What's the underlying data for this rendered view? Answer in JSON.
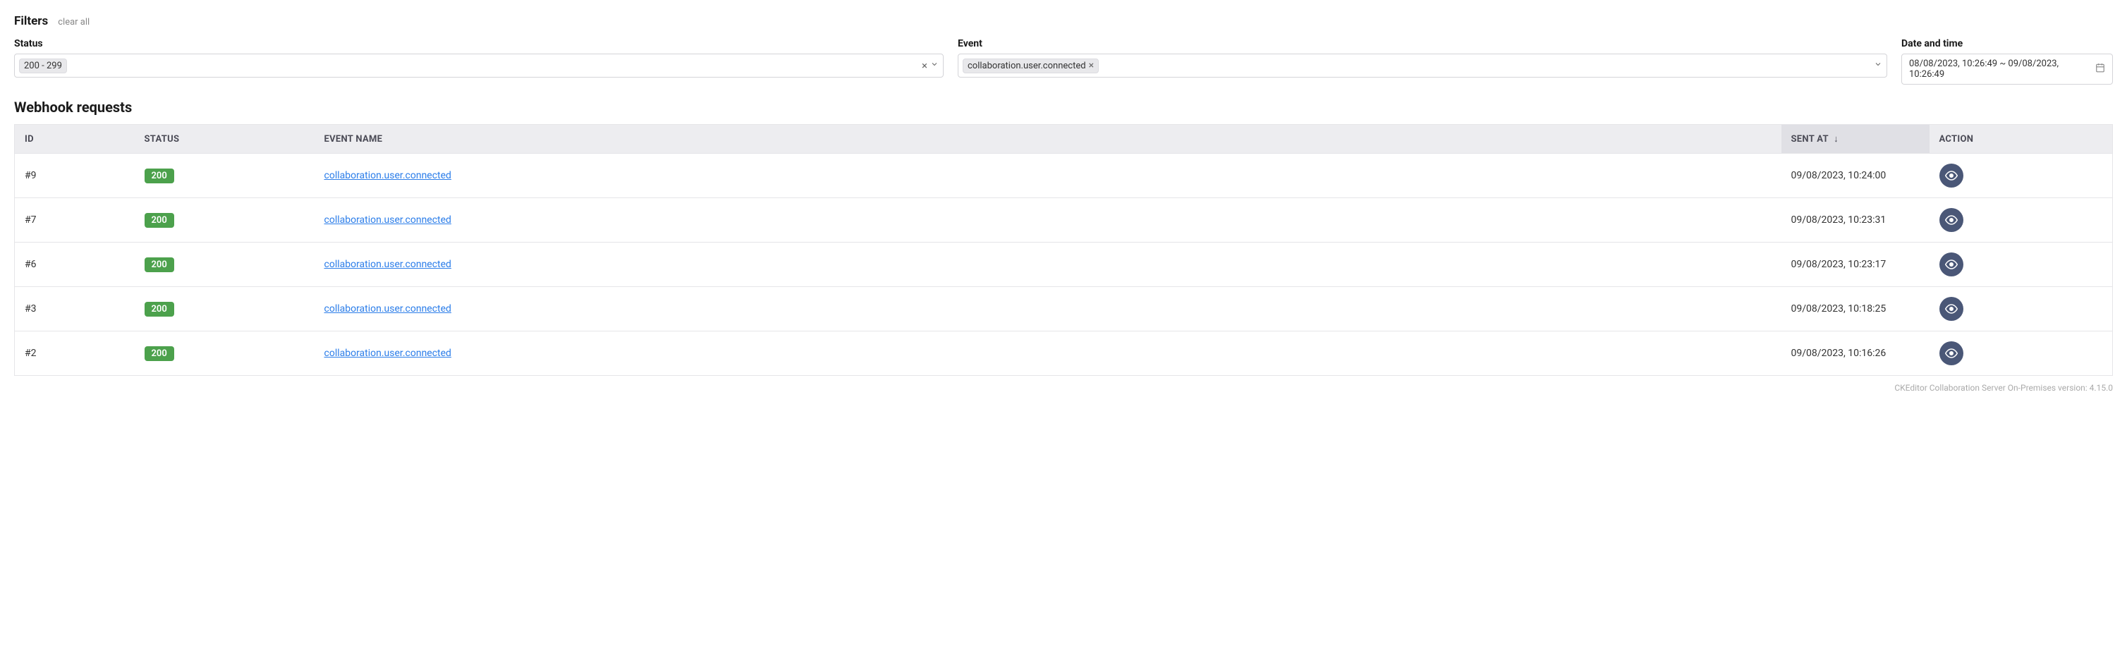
{
  "filters": {
    "title": "Filters",
    "clear_label": "clear all",
    "status": {
      "label": "Status",
      "tag": "200 - 299"
    },
    "event": {
      "label": "Event",
      "tag": "collaboration.user.connected"
    },
    "date": {
      "label": "Date and time",
      "value": "08/08/2023, 10:26:49 ~ 09/08/2023, 10:26:49"
    }
  },
  "section_title": "Webhook requests",
  "table": {
    "headers": {
      "id": "ID",
      "status": "STATUS",
      "event": "EVENT NAME",
      "sent": "SENT AT",
      "sort_arrow": "↓",
      "action": "ACTION"
    },
    "rows": [
      {
        "id": "#9",
        "status": "200",
        "event": "collaboration.user.connected",
        "sent": "09/08/2023, 10:24:00"
      },
      {
        "id": "#7",
        "status": "200",
        "event": "collaboration.user.connected",
        "sent": "09/08/2023, 10:23:31"
      },
      {
        "id": "#6",
        "status": "200",
        "event": "collaboration.user.connected",
        "sent": "09/08/2023, 10:23:17"
      },
      {
        "id": "#3",
        "status": "200",
        "event": "collaboration.user.connected",
        "sent": "09/08/2023, 10:18:25"
      },
      {
        "id": "#2",
        "status": "200",
        "event": "collaboration.user.connected",
        "sent": "09/08/2023, 10:16:26"
      }
    ]
  },
  "footer": "CKEditor Collaboration Server On-Premises version: 4.15.0"
}
